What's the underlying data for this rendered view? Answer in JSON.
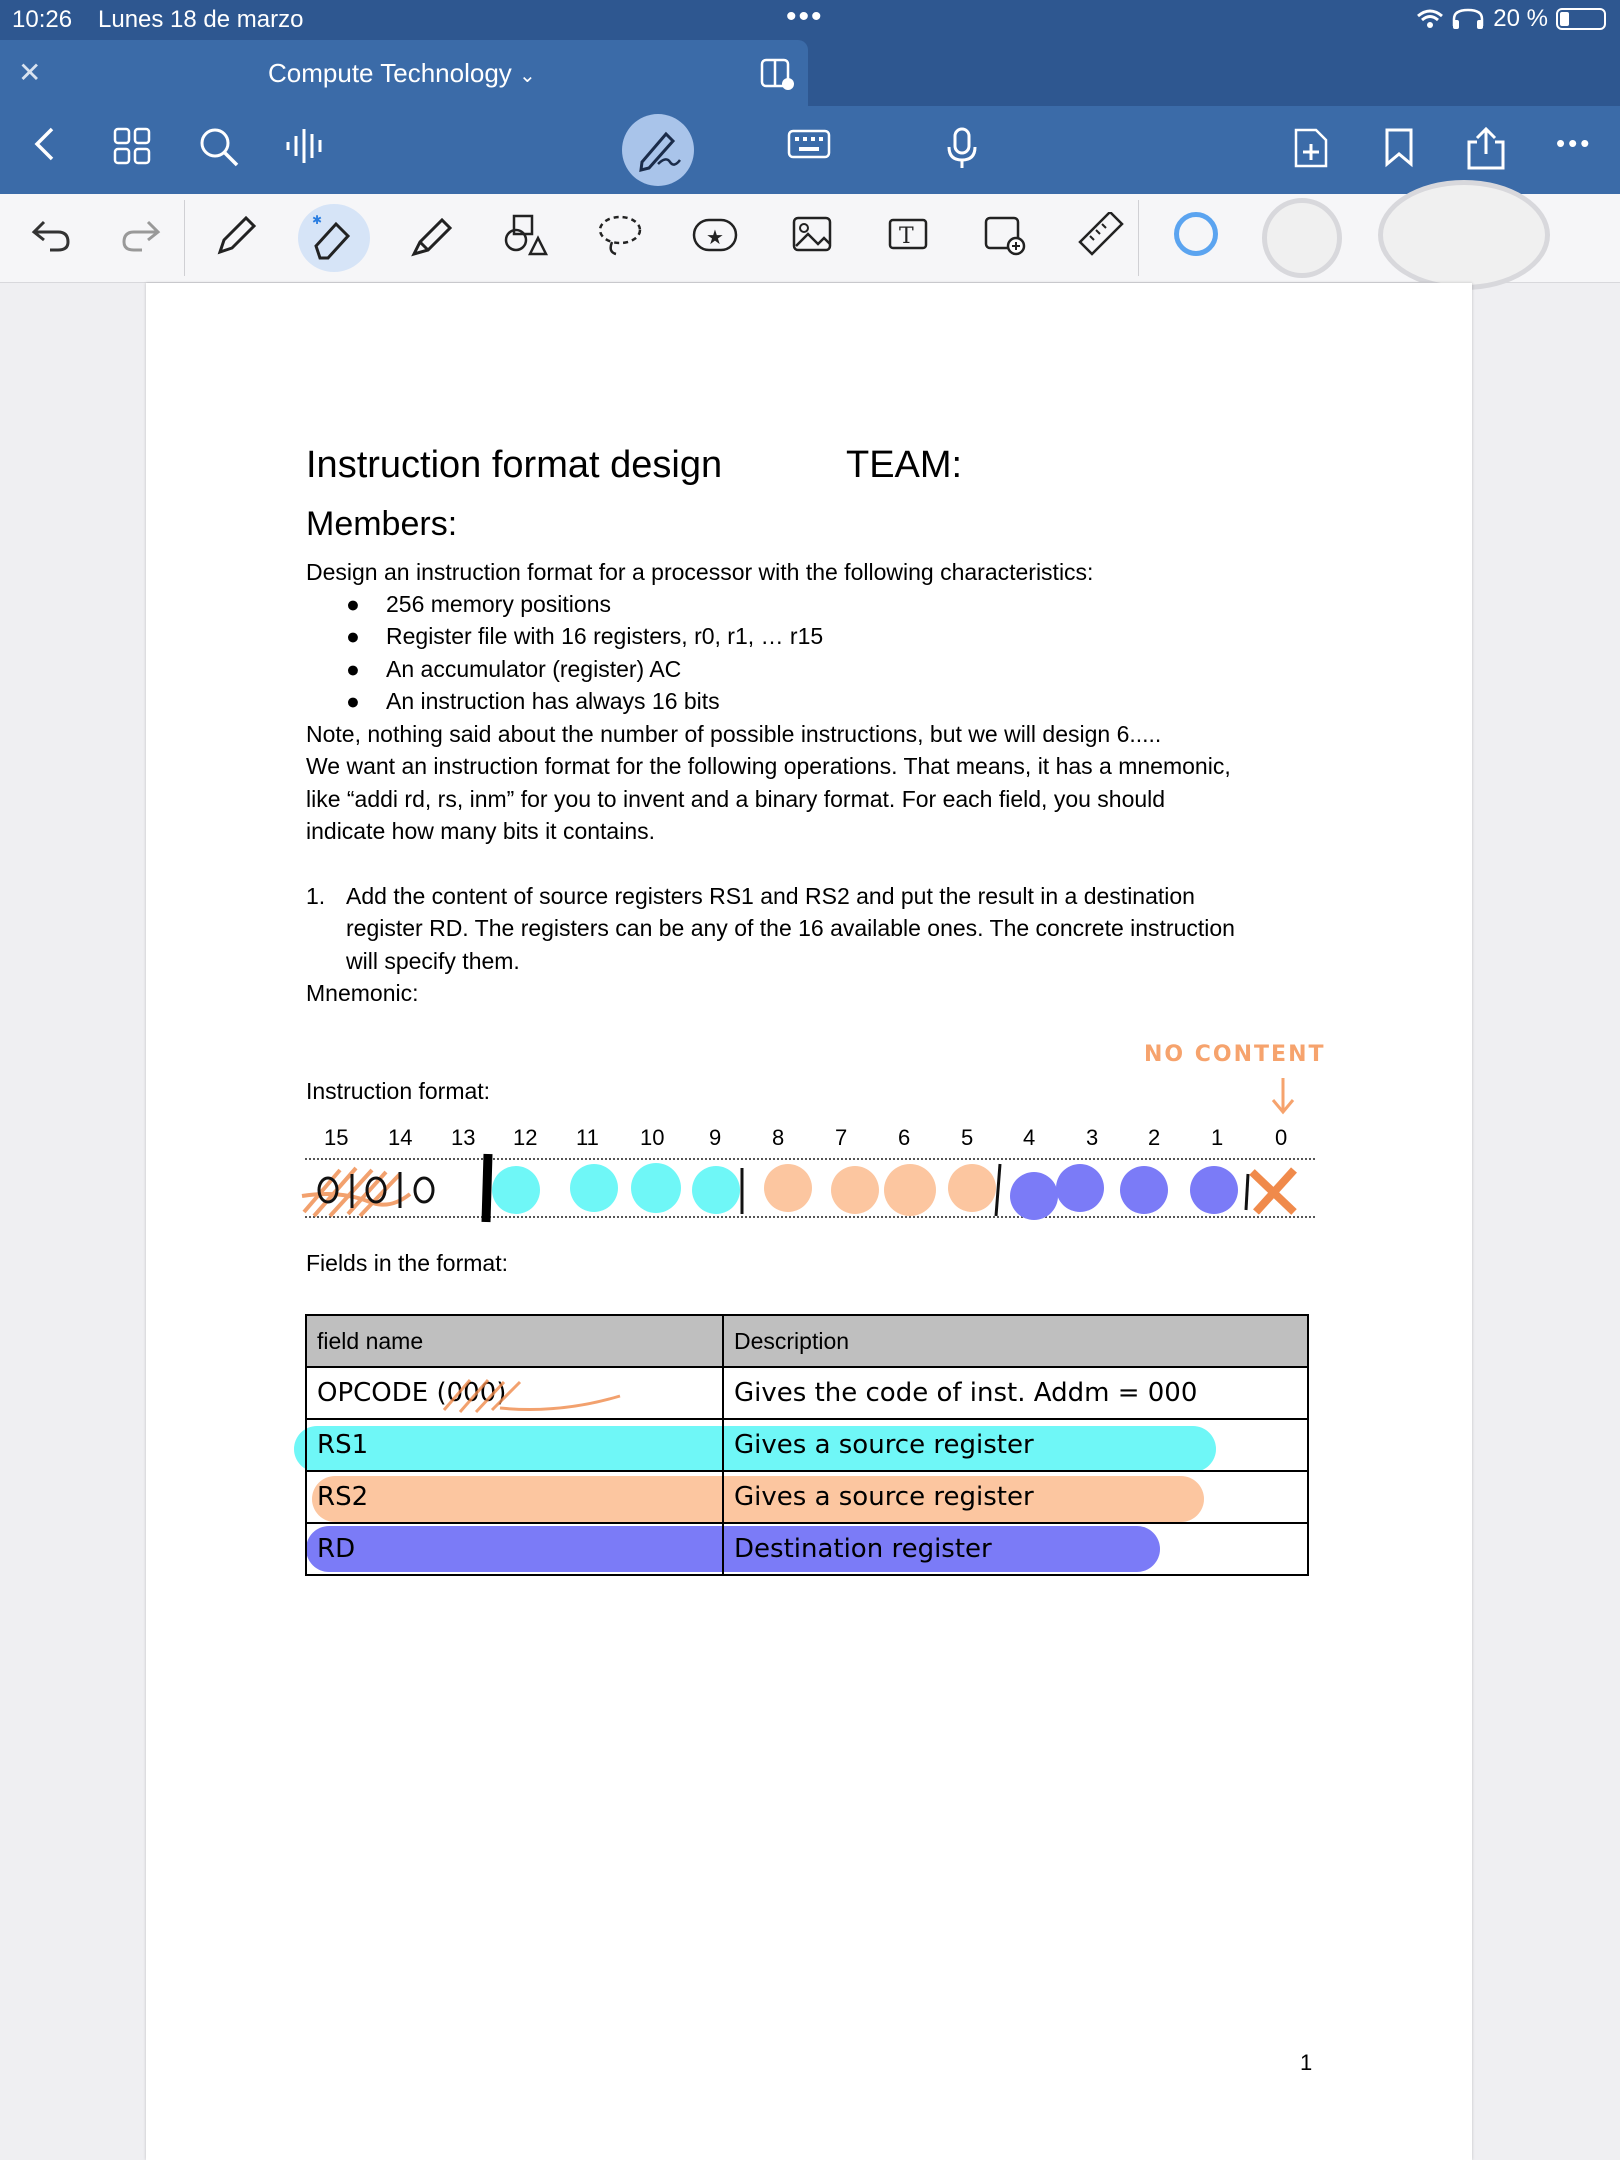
{
  "status": {
    "time": "10:26",
    "date": "Lunes 18 de marzo",
    "battery": "20 %"
  },
  "tab": {
    "title": "Compute Technology"
  },
  "toolbar": {
    "more": "•••"
  },
  "document": {
    "title": "Instruction format design",
    "team_label": "TEAM:",
    "members_label": "Members:",
    "intro": "Design an instruction format for a processor with the following characteristics:",
    "bullets": [
      "256 memory positions",
      "Register file with 16 registers, r0, r1, … r15",
      "An accumulator (register) AC",
      "An instruction has always 16 bits"
    ],
    "note_lines": [
      "Note, nothing said about the number of possible instructions, but we will design 6.....",
      "We want an instruction format for the following operations. That means, it has a mnemonic,",
      "like “addi rd, rs, inm” for you to invent and a binary format. For each field, you should",
      "indicate how many bits it contains."
    ],
    "item1_number": "1.",
    "item1_lines": [
      "Add the content of source registers RS1 and RS2 and put the result in a destination",
      "register RD. The registers can be any of the 16 available ones. The concrete instruction",
      "will specify them."
    ],
    "mnemonic_label": "Mnemonic:",
    "format_label": "Instruction format:",
    "bit_numbers": [
      "15",
      "14",
      "13",
      "12",
      "11",
      "10",
      "9",
      "8",
      "7",
      "6",
      "5",
      "4",
      "3",
      "2",
      "1",
      "0"
    ],
    "fields_label": "Fields in the format:",
    "table_headers": [
      "field name",
      "Description"
    ],
    "page_number": "1"
  },
  "handwriting": {
    "no_content": "NO    CONTENT",
    "opcode_bits": "0|0|0",
    "opcode_field": "OPCODE (000)",
    "opcode_desc": "Gives the code of inst. Addm = 000",
    "rs1_field": "RS1",
    "rs1_desc": "Gives a source register",
    "rs2_field": "RS2",
    "rs2_desc": "Gives a source register",
    "rd_field": "RD",
    "rd_desc": "Destination register"
  },
  "colors": {
    "header_blue": "#2e5790",
    "toolbar_blue": "#3b6ba8",
    "cyan": "#6ff7f7",
    "peach": "#fcc6a0",
    "violet": "#7b7bf7",
    "orange_ink": "#f08a4b"
  }
}
